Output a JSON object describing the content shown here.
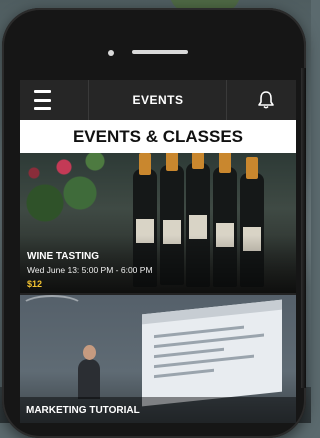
{
  "topbar": {
    "title": "EVENTS",
    "menu_icon": "hamburger-menu-icon",
    "notification_icon": "bell-icon"
  },
  "section": {
    "heading": "EVENTS & CLASSES"
  },
  "events": [
    {
      "title": "WINE TASTING",
      "datetime": "Wed June 13: 5:00 PM - 6:00 PM",
      "price": "$12",
      "image": "wine-bottles-photo"
    },
    {
      "title": "MARKETING TUTORIAL",
      "image": "presentation-photo"
    }
  ],
  "colors": {
    "bar_bg": "#262626",
    "price_accent": "#f2c230",
    "heading_bg": "#ffffff"
  }
}
